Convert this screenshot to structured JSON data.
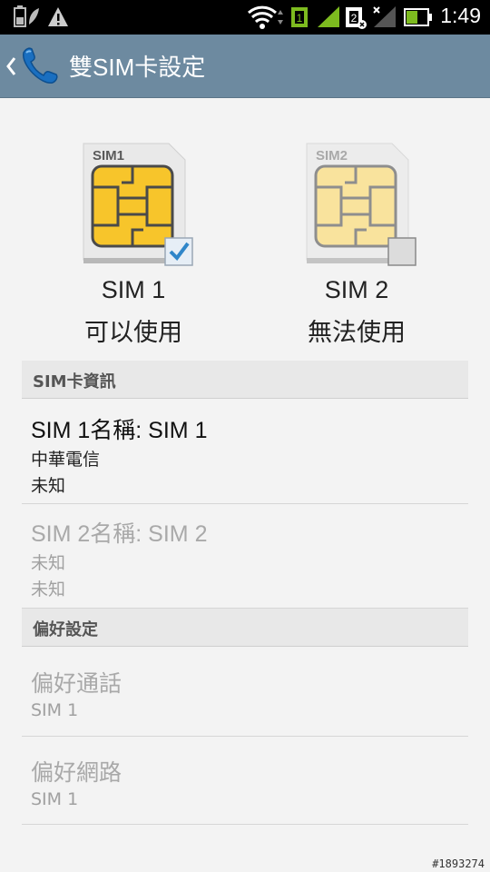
{
  "statusbar": {
    "time": "1:49",
    "icons": [
      "battery-saver-icon",
      "warning-icon",
      "wifi-icon",
      "sim1-signal-icon",
      "sim2-no-signal-icon",
      "battery-icon"
    ]
  },
  "actionbar": {
    "title": "雙SIM卡設定",
    "icon": "phone-icon"
  },
  "sims": [
    {
      "card_label": "SIM1",
      "name": "SIM 1",
      "status": "可以使用",
      "checked": true,
      "color": "#f7c52b"
    },
    {
      "card_label": "SIM2",
      "name": "SIM 2",
      "status": "無法使用",
      "checked": false,
      "color": "#f9e39d"
    }
  ],
  "sim_info": {
    "header": "SIM卡資訊",
    "items": [
      {
        "title": "SIM 1名稱: SIM 1",
        "line1": "中華電信",
        "line2": "未知",
        "enabled": true
      },
      {
        "title": "SIM 2名稱: SIM 2",
        "line1": "未知",
        "line2": "未知",
        "enabled": false
      }
    ]
  },
  "preferences": {
    "header": "偏好設定",
    "items": [
      {
        "title": "偏好通話",
        "summary": "SIM 1",
        "enabled": false
      },
      {
        "title": "偏好網路",
        "summary": "SIM 1",
        "enabled": false
      }
    ]
  },
  "watermark": "#1893274"
}
